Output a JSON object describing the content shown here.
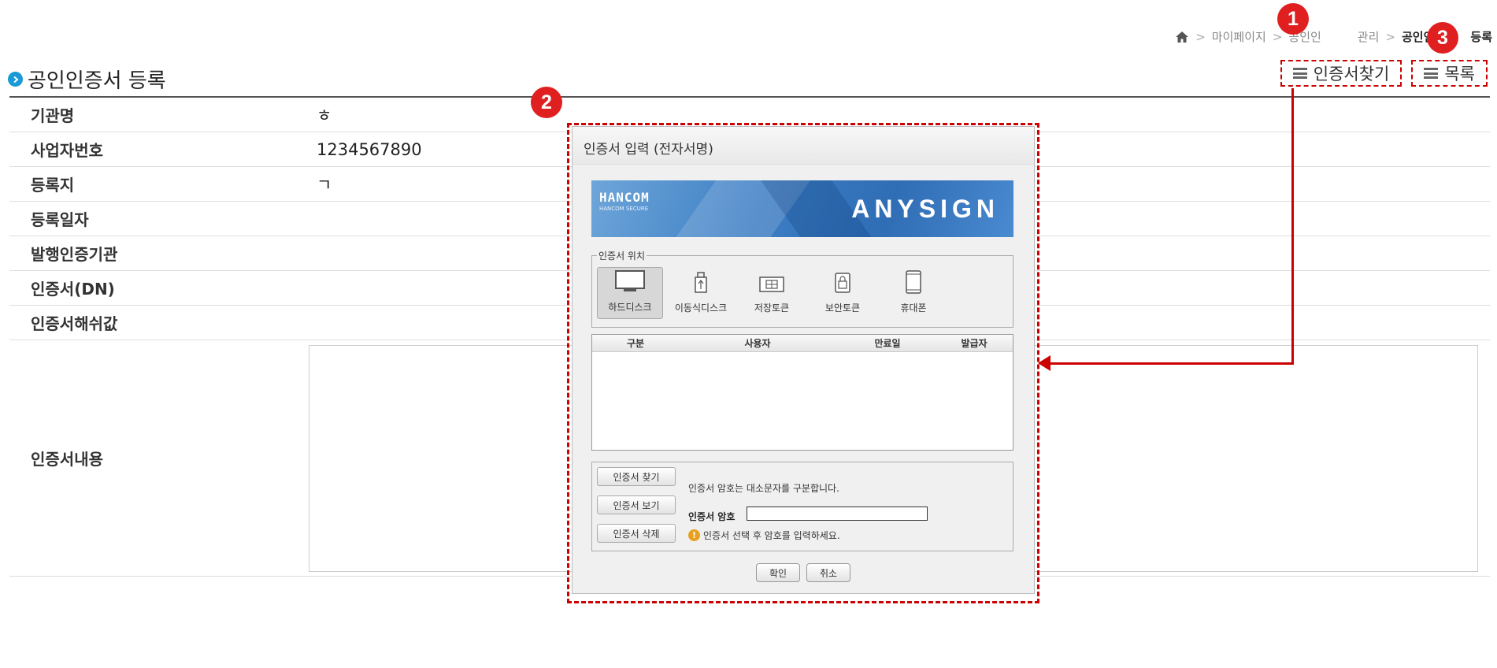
{
  "breadcrumb": {
    "items": [
      "마이페이지",
      "공인인",
      "관리"
    ],
    "current": "공인인",
    "current_suffix": "등록"
  },
  "page": {
    "title": "공인인증서 등록"
  },
  "buttons": {
    "find_cert": "인증서찾기",
    "list": "목록"
  },
  "badges": [
    "1",
    "2",
    "3"
  ],
  "rows": [
    {
      "label": "기관명",
      "value": "ㅎ"
    },
    {
      "label": "사업자번호",
      "value": "1234567890"
    },
    {
      "label": "등록지",
      "value": "ㄱ"
    },
    {
      "label": "등록일자",
      "value": ""
    },
    {
      "label": "발행인증기관",
      "value": ""
    },
    {
      "label": "인증서(DN)",
      "value": ""
    },
    {
      "label": "인증서해쉬값",
      "value": ""
    },
    {
      "label": "인증서내용",
      "value": ""
    }
  ],
  "dialog": {
    "title": "인증서 입력 (전자서명)",
    "banner_brand": "HANCOM",
    "banner_brand_sub": "HANCOM SECURE",
    "banner_product": "ANYSIGN",
    "location_legend": "인증서 위치",
    "locations": [
      "하드디스크",
      "이동식디스크",
      "저장토큰",
      "보안토큰",
      "휴대폰"
    ],
    "columns": [
      "구분",
      "사용자",
      "만료일",
      "발급자"
    ],
    "side_buttons": [
      "인증서 찾기",
      "인증서 보기",
      "인증서 삭제"
    ],
    "hint": "인증서 암호는 대소문자를 구분합니다.",
    "password_label": "인증서 암호",
    "warning": "인증서 선택 후 암호를 입력하세요.",
    "ok": "확인",
    "cancel": "취소"
  },
  "colors": {
    "accent": "#1a9ad6",
    "highlight": "#cc0000",
    "badge": "#e02020"
  }
}
